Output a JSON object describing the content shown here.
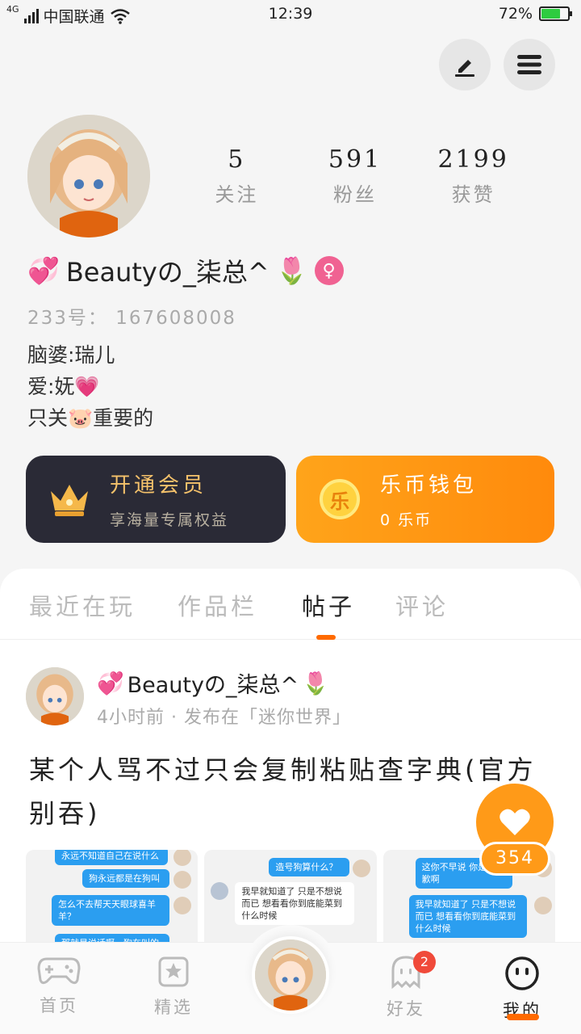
{
  "status_bar": {
    "network": "4G",
    "carrier": "中国联通",
    "time": "12:39",
    "battery": "72%"
  },
  "header": {
    "edit_icon": "pencil-icon",
    "menu_icon": "hamburger-menu-icon"
  },
  "profile": {
    "stats": [
      {
        "value": "5",
        "label": "关注"
      },
      {
        "value": "591",
        "label": "粉丝"
      },
      {
        "value": "2199",
        "label": "获赞"
      }
    ],
    "username_prefix": "💞",
    "username": "Beautyの_柒总^",
    "username_suffix": "🌷",
    "gender_symbol": "♀",
    "uid": "233号： 167608008",
    "bio": [
      "脑婆:瑞儿",
      "爱:妩💗",
      "只关🐷重要的"
    ]
  },
  "cards": {
    "vip": {
      "title": "开通会员",
      "subtitle": "享海量专属权益"
    },
    "wallet": {
      "coin_glyph": "乐",
      "title": "乐币钱包",
      "subtitle": "0 乐币"
    }
  },
  "tabs": [
    {
      "label": "最近在玩",
      "active": false
    },
    {
      "label": "作品栏",
      "active": false
    },
    {
      "label": "帖子",
      "active": true
    },
    {
      "label": "评论",
      "active": false
    }
  ],
  "post": {
    "author_prefix": "💞",
    "author": "Beautyの_柒总^",
    "author_suffix": "🌷",
    "meta": "4小时前 · 发布在「迷你世界」",
    "title": "某个人骂不过只会复制粘贴查字典(官方别吞)",
    "thumbs": [
      [
        "永远不知道自己在说什么",
        "狗永远都是在狗叫",
        "怎么不去帮天天眼球喜羊羊？",
        "那就是说话啊，狗在叫的"
      ],
      [
        "造号狗算什么？",
        "我早就知道了 只是不想说而已 想看看你到底能菜到什么时候"
      ],
      [
        "这你不早说 你是 抱歉啊",
        "我早就知道了 只是不想说而已 想看看你到底能菜到什么时候"
      ]
    ],
    "likes": "354"
  },
  "bottom_nav": [
    {
      "label": "首页",
      "icon": "gamepad-icon",
      "active": false
    },
    {
      "label": "精选",
      "icon": "star-bookmark-icon",
      "active": false
    },
    {
      "label": "",
      "icon": "avatar-center",
      "active": false
    },
    {
      "label": "好友",
      "icon": "ghost-friends-icon",
      "active": false,
      "badge": "2"
    },
    {
      "label": "我的",
      "icon": "smiley-face-icon",
      "active": true
    }
  ],
  "colors": {
    "accent": "#ff6a00",
    "vip_card": "#2a2a36",
    "wallet_card": "#ff9a18",
    "gender": "#f06292"
  }
}
